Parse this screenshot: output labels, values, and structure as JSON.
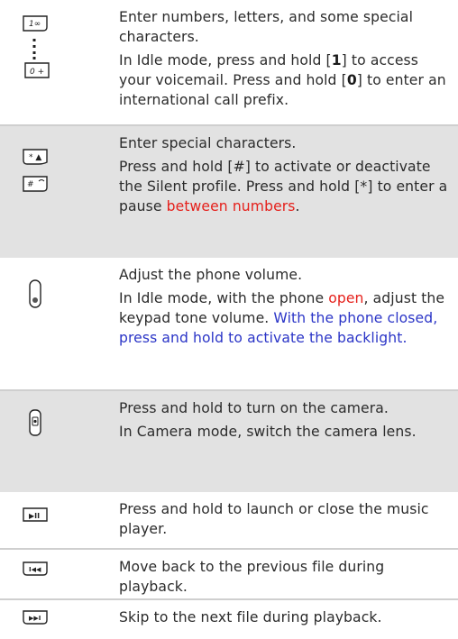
{
  "rows": [
    {
      "line1": "Enter numbers, letters, and some special characters.",
      "line2_parts": [
        "In Idle mode, press and hold [",
        "1",
        "] to access your voicemail. Press and hold [",
        "0",
        "] to enter an international call prefix."
      ],
      "icons": [
        "key-1-icon",
        "ellipsis-vertical-icon",
        "key-0-icon"
      ],
      "key1_label": "1∞",
      "key0_label": "0 +"
    },
    {
      "line1": "Enter special characters.",
      "line2_parts": [
        "Press and hold [",
        "#",
        "] to activate or deactivate the Silent profile. Press and hold [",
        "*",
        "] to enter a pause ",
        "between numbers",
        "."
      ],
      "icons": [
        "star-key-icon",
        "hash-key-icon"
      ],
      "star_label": "* ▲",
      "hash_label": "#"
    },
    {
      "line1": "Adjust the phone volume.",
      "line2_parts": [
        "In Idle mode, with the phone ",
        "open",
        ", adjust the keypad tone volume. ",
        "With the phone closed, press and hold to activate the backlight."
      ],
      "icons": [
        "volume-key-icon"
      ]
    },
    {
      "line1": "Press and hold to turn on the camera.",
      "line2": "In Camera mode, switch the camera lens.",
      "icons": [
        "camera-key-icon"
      ]
    },
    {
      "line1": "Press and hold to launch or close the music player.",
      "icons": [
        "play-pause-key-icon"
      ],
      "key_label": "▶II"
    },
    {
      "line1": "Move back to the previous file during playback.",
      "icons": [
        "rewind-key-icon"
      ],
      "key_label": "I◀◀"
    },
    {
      "line1": "Skip to the next file during playback.",
      "icons": [
        "forward-key-icon"
      ],
      "key_label": "▶▶I"
    }
  ],
  "colors": {
    "shade": "#e2e2e2",
    "text": "#2b2b2b",
    "red_highlight": "#e5201b",
    "blue_highlight": "#2b35c7"
  }
}
